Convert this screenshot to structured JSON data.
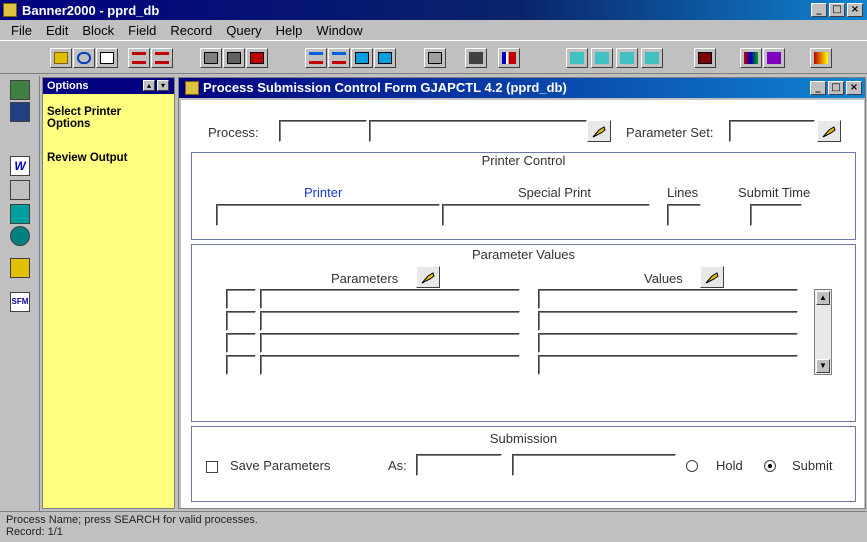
{
  "window": {
    "title": "Banner2000 - pprd_db"
  },
  "menu": [
    "File",
    "Edit",
    "Block",
    "Field",
    "Record",
    "Query",
    "Help",
    "Window"
  ],
  "options_panel": {
    "title": "Options",
    "items": [
      "Select Printer Options",
      "Review Output"
    ]
  },
  "form": {
    "title": "Process Submission Control Form  GJAPCTL  4.2  (pprd_db)",
    "process_label": "Process:",
    "parameter_set_label": "Parameter Set:",
    "printer_control": {
      "title": "Printer Control",
      "printer_label": "Printer",
      "special_print_label": "Special Print",
      "lines_label": "Lines",
      "submit_time_label": "Submit Time"
    },
    "parameter_values": {
      "title": "Parameter Values",
      "parameters_label": "Parameters",
      "values_label": "Values"
    },
    "submission": {
      "title": "Submission",
      "save_parameters_label": "Save Parameters",
      "as_label": "As:",
      "hold_label": "Hold",
      "submit_label": "Submit"
    }
  },
  "status": {
    "line1": "Process Name; press SEARCH for valid processes.",
    "line2": "Record: 1/1"
  },
  "colors": {
    "title_bar": "#000080",
    "options_bg": "#ffff80",
    "printer_label": "#1a3ccf"
  }
}
